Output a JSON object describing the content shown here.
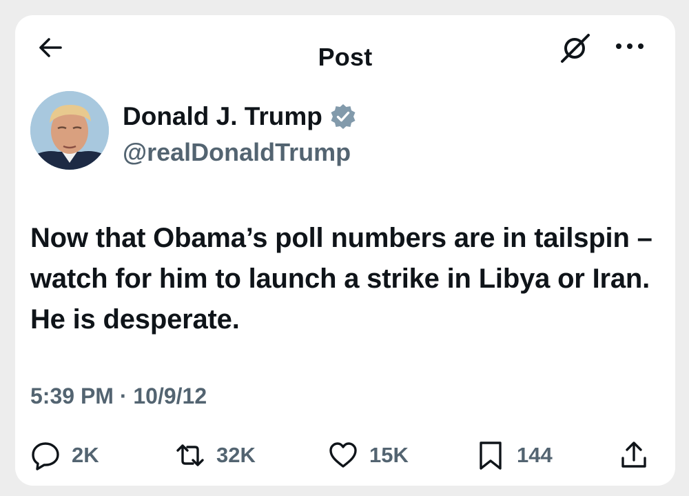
{
  "header": {
    "title": "Post"
  },
  "author": {
    "name": "Donald J. Trump",
    "handle": "@realDonaldTrump",
    "verified_badge_color": "#829aab"
  },
  "post": {
    "text": "Now that Obama’s poll numbers are in tailspin – watch for him to launch a strike in Libya or Iran.  He is desperate.",
    "meta": "5:39 PM · 10/9/12"
  },
  "actions": {
    "replies": "2K",
    "reposts": "32K",
    "likes": "15K",
    "bookmarks": "144"
  },
  "icons": [
    "back-arrow-icon",
    "grok-icon",
    "more-icon",
    "verified-badge-icon",
    "reply-icon",
    "repost-icon",
    "like-icon",
    "bookmark-icon",
    "share-icon"
  ]
}
